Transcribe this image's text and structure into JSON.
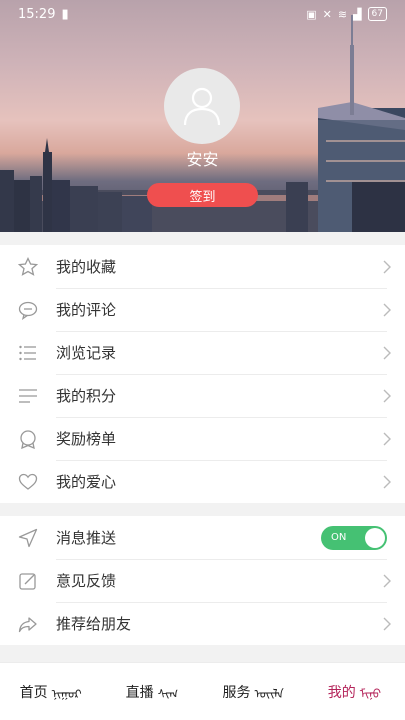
{
  "status": {
    "time": "15:29",
    "battery": "67"
  },
  "profile": {
    "username": "安安",
    "checkin_label": "签到"
  },
  "menu_group1": [
    {
      "label": "我的收藏",
      "icon": "star-icon"
    },
    {
      "label": "我的评论",
      "icon": "comment-icon"
    },
    {
      "label": "浏览记录",
      "icon": "list-icon"
    },
    {
      "label": "我的积分",
      "icon": "lines-icon"
    },
    {
      "label": "奖励榜单",
      "icon": "badge-icon"
    },
    {
      "label": "我的爱心",
      "icon": "heart-icon"
    }
  ],
  "menu_group2": [
    {
      "label": "消息推送",
      "icon": "send-icon",
      "toggle_text": "ON"
    },
    {
      "label": "意见反馈",
      "icon": "edit-icon"
    },
    {
      "label": "推荐给朋友",
      "icon": "share-icon"
    }
  ],
  "nav": [
    {
      "label": "首页",
      "mongol": "ᠨᠢᠭᠤᠷ"
    },
    {
      "label": "直播",
      "mongol": "ᠰᠢᠭ᠋"
    },
    {
      "label": "服务",
      "mongol": "ᠦᠢᠯᠡ"
    },
    {
      "label": "我的",
      "mongol": "ᠮᠢᠨᠤ"
    }
  ],
  "colors": {
    "accent": "#ef4f4f",
    "toggle_on": "#45c173",
    "active_tab": "#b4245a"
  }
}
